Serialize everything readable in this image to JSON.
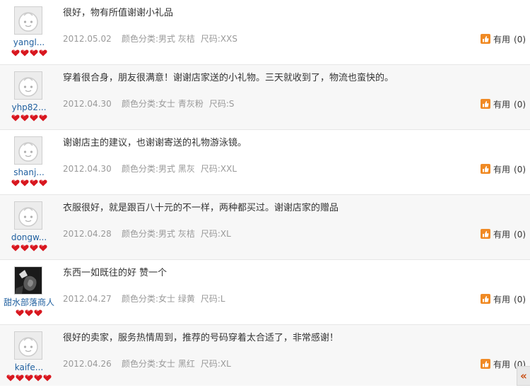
{
  "reviews": [
    {
      "username": "yangl...",
      "avatar": "default-avatar",
      "rating_hearts": 4,
      "content": "很好，物有所值谢谢小礼品",
      "date": "2012.05.02",
      "color_class": "颜色分类:男式 灰桔",
      "size": "尺码:XXS",
      "useful_label": "有用",
      "useful_count": "(0)"
    },
    {
      "username": "yhp82...",
      "avatar": "default-avatar",
      "rating_hearts": 4,
      "content": "穿着很合身，朋友很满意！谢谢店家送的小礼物。三天就收到了，物流也蛮快的。",
      "date": "2012.04.30",
      "color_class": "颜色分类:女士 青灰粉",
      "size": "尺码:S",
      "useful_label": "有用",
      "useful_count": "(0)"
    },
    {
      "username": "shanj...",
      "avatar": "default-avatar",
      "rating_hearts": 4,
      "content": "谢谢店主的建议，也谢谢寄送的礼物游泳镜。",
      "date": "2012.04.30",
      "color_class": "颜色分类:男式 黑灰",
      "size": "尺码:XXL",
      "useful_label": "有用",
      "useful_count": "(0)"
    },
    {
      "username": "dongw...",
      "avatar": "default-avatar",
      "rating_hearts": 4,
      "content": "衣服很好，就是跟百八十元的不一样，两种都买过。谢谢店家的赠品",
      "date": "2012.04.28",
      "color_class": "颜色分类:男式 灰桔",
      "size": "尺码:XL",
      "useful_label": "有用",
      "useful_count": "(0)"
    },
    {
      "username": "甜水部落商人",
      "avatar": "photo-avatar",
      "rating_hearts": 3,
      "content": "东西一如既往的好 赞一个",
      "date": "2012.04.27",
      "color_class": "颜色分类:女士 绿黄",
      "size": "尺码:L",
      "useful_label": "有用",
      "useful_count": "(0)"
    },
    {
      "username": "kaife...",
      "avatar": "default-avatar",
      "rating_hearts": 5,
      "content": "很好的卖家，服务热情周到，推荐的号码穿着太合适了，非常感谢！",
      "date": "2012.04.26",
      "color_class": "颜色分类:女士 黑红",
      "size": "尺码:XL",
      "useful_label": "有用",
      "useful_count": "(0)"
    }
  ],
  "collapse_tab_glyph": "«",
  "colors": {
    "username": "#1f5f9f",
    "heart": "#d8171f",
    "useful_icon": "#f08a24",
    "meta_text": "#999999",
    "content_text": "#333333"
  }
}
